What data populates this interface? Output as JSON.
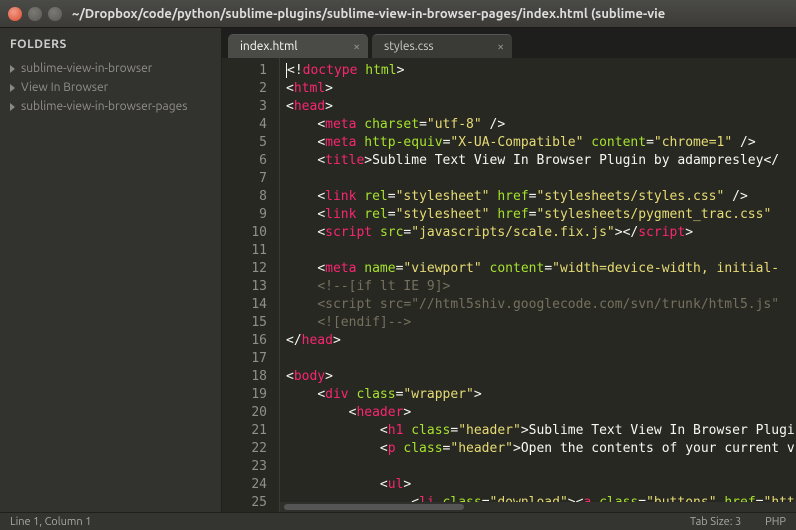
{
  "window": {
    "title": "~/Dropbox/code/python/sublime-plugins/sublime-view-in-browser-pages/index.html (sublime-vie"
  },
  "sidebar": {
    "header": "FOLDERS",
    "items": [
      {
        "label": "sublime-view-in-browser"
      },
      {
        "label": "View In Browser"
      },
      {
        "label": "sublime-view-in-browser-pages"
      }
    ]
  },
  "tabs": [
    {
      "label": "index.html",
      "active": true
    },
    {
      "label": "styles.css",
      "active": false
    }
  ],
  "code": {
    "lines": [
      {
        "n": "1",
        "html": "<span class='hl-punc'>&lt;!</span><span class='hl-tag'>doctype</span> <span class='hl-attr'>html</span><span class='hl-punc'>&gt;</span>"
      },
      {
        "n": "2",
        "html": "<span class='hl-punc'>&lt;</span><span class='hl-tag'>html</span><span class='hl-punc'>&gt;</span>"
      },
      {
        "n": "3",
        "html": "<span class='hl-punc'>&lt;</span><span class='hl-tag'>head</span><span class='hl-punc'>&gt;</span>"
      },
      {
        "n": "4",
        "html": "    <span class='hl-punc'>&lt;</span><span class='hl-tag'>meta</span> <span class='hl-attr'>charset</span><span class='hl-punc'>=</span><span class='hl-str'>\"utf-8\"</span> <span class='hl-punc'>/&gt;</span>"
      },
      {
        "n": "5",
        "html": "    <span class='hl-punc'>&lt;</span><span class='hl-tag'>meta</span> <span class='hl-attr'>http-equiv</span><span class='hl-punc'>=</span><span class='hl-str'>\"X-UA-Compatible\"</span> <span class='hl-attr'>content</span><span class='hl-punc'>=</span><span class='hl-str'>\"chrome=1\"</span> <span class='hl-punc'>/&gt;</span>"
      },
      {
        "n": "6",
        "html": "    <span class='hl-punc'>&lt;</span><span class='hl-tag'>title</span><span class='hl-punc'>&gt;</span>Sublime Text View In Browser Plugin by adampresley<span class='hl-punc'>&lt;/</span>"
      },
      {
        "n": "7",
        "html": " "
      },
      {
        "n": "8",
        "html": "    <span class='hl-punc'>&lt;</span><span class='hl-tag'>link</span> <span class='hl-attr'>rel</span><span class='hl-punc'>=</span><span class='hl-str'>\"stylesheet\"</span> <span class='hl-attr'>href</span><span class='hl-punc'>=</span><span class='hl-str'>\"stylesheets/styles.css\"</span> <span class='hl-punc'>/&gt;</span>"
      },
      {
        "n": "9",
        "html": "    <span class='hl-punc'>&lt;</span><span class='hl-tag'>link</span> <span class='hl-attr'>rel</span><span class='hl-punc'>=</span><span class='hl-str'>\"stylesheet\"</span> <span class='hl-attr'>href</span><span class='hl-punc'>=</span><span class='hl-str'>\"stylesheets/pygment_trac.css\"</span> "
      },
      {
        "n": "10",
        "html": "    <span class='hl-punc'>&lt;</span><span class='hl-tag'>script</span> <span class='hl-attr'>src</span><span class='hl-punc'>=</span><span class='hl-str'>\"javascripts/scale.fix.js\"</span><span class='hl-punc'>&gt;&lt;/</span><span class='hl-tag'>script</span><span class='hl-punc'>&gt;</span>"
      },
      {
        "n": "11",
        "html": " "
      },
      {
        "n": "12",
        "html": "    <span class='hl-punc'>&lt;</span><span class='hl-tag'>meta</span> <span class='hl-attr'>name</span><span class='hl-punc'>=</span><span class='hl-str'>\"viewport\"</span> <span class='hl-attr'>content</span><span class='hl-punc'>=</span><span class='hl-str'>\"width=device-width, initial-</span>"
      },
      {
        "n": "13",
        "html": "    <span class='hl-cmt'>&lt;!--[if lt IE 9]&gt;</span>"
      },
      {
        "n": "14",
        "html": "    <span class='hl-cmt'>&lt;script src=\"//html5shiv.googlecode.com/svn/trunk/html5.js\"</span>"
      },
      {
        "n": "15",
        "html": "    <span class='hl-cmt'>&lt;![endif]--&gt;</span>"
      },
      {
        "n": "16",
        "html": "<span class='hl-punc'>&lt;/</span><span class='hl-tag'>head</span><span class='hl-punc'>&gt;</span>"
      },
      {
        "n": "17",
        "html": " "
      },
      {
        "n": "18",
        "html": "<span class='hl-punc'>&lt;</span><span class='hl-tag'>body</span><span class='hl-punc'>&gt;</span>"
      },
      {
        "n": "19",
        "html": "    <span class='hl-punc'>&lt;</span><span class='hl-tag'>div</span> <span class='hl-attr'>class</span><span class='hl-punc'>=</span><span class='hl-str'>\"wrapper\"</span><span class='hl-punc'>&gt;</span>"
      },
      {
        "n": "20",
        "html": "        <span class='hl-punc'>&lt;</span><span class='hl-tag'>header</span><span class='hl-punc'>&gt;</span>"
      },
      {
        "n": "21",
        "html": "            <span class='hl-punc'>&lt;</span><span class='hl-tag'>h1</span> <span class='hl-attr'>class</span><span class='hl-punc'>=</span><span class='hl-str'>\"header\"</span><span class='hl-punc'>&gt;</span>Sublime Text View In Browser Plugi"
      },
      {
        "n": "22",
        "html": "            <span class='hl-punc'>&lt;</span><span class='hl-tag'>p</span> <span class='hl-attr'>class</span><span class='hl-punc'>=</span><span class='hl-str'>\"header\"</span><span class='hl-punc'>&gt;</span>Open the contents of your current v"
      },
      {
        "n": "23",
        "html": " "
      },
      {
        "n": "24",
        "html": "            <span class='hl-punc'>&lt;</span><span class='hl-tag'>ul</span><span class='hl-punc'>&gt;</span>"
      },
      {
        "n": "25",
        "html": "                <span class='hl-punc'>&lt;</span><span class='hl-tag'>li</span> <span class='hl-attr'>class</span><span class='hl-punc'>=</span><span class='hl-str'>\"download\"</span><span class='hl-punc'>&gt;&lt;</span><span class='hl-tag'>a</span> <span class='hl-attr'>class</span><span class='hl-punc'>=</span><span class='hl-str'>\"buttons\"</span> <span class='hl-attr'>href</span><span class='hl-punc'>=</span><span class='hl-str'>\"http</span>"
      }
    ]
  },
  "status": {
    "left": "Line 1, Column 1",
    "tab_size": "Tab Size: 3",
    "lang": "PHP"
  }
}
